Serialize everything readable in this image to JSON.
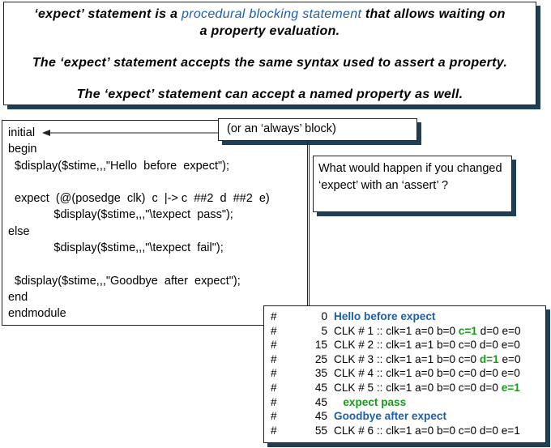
{
  "top": {
    "line1a": "‘expect’ statement is a ",
    "line1b": "procedural blocking statement",
    "line1c": " that allows waiting on",
    "line2": "a property evaluation.",
    "line3": "The ‘expect’ statement accepts the same syntax used to assert a property.",
    "line4": "The ‘expect’ statement can accept a named property as well."
  },
  "code": {
    "lines": [
      "initial",
      "begin",
      "  $display($stime,,,\"Hello  before  expect\");",
      "",
      "  expect  (@(posedge  clk)  c  |-> c  ##2  d  ##2  e)",
      "              $display($stime,,,\"\\texpect  pass\");",
      "else",
      "              $display($stime,,,\"\\texpect  fail\");",
      "",
      "  $display($stime,,,\"Goodbye  after  expect\");",
      "end",
      "endmodule"
    ]
  },
  "callout": {
    "text": "(or an ‘always’ block)"
  },
  "question": {
    "text": "What would happen if you changed ‘expect’ with an ‘assert’ ?"
  },
  "output": {
    "hash": "#",
    "rows": [
      {
        "time": "0",
        "pre": "",
        "hl": "Hello before expect",
        "post": "",
        "hl_color": "blue"
      },
      {
        "time": "5",
        "pre": "CLK # 1 :: clk=1 a=0 b=0 ",
        "hl": "c=1",
        "post": " d=0 e=0",
        "hl_color": "green"
      },
      {
        "time": "15",
        "pre": "CLK # 2 :: clk=1 a=1 b=0 c=0 d=0 e=0",
        "hl": "",
        "post": "",
        "hl_color": "none"
      },
      {
        "time": "25",
        "pre": "CLK # 3 :: clk=1 a=1 b=0 c=0 ",
        "hl": "d=1",
        "post": " e=0",
        "hl_color": "green"
      },
      {
        "time": "35",
        "pre": "CLK # 4 :: clk=1 a=0 b=0 c=0 d=0 e=0",
        "hl": "",
        "post": "",
        "hl_color": "none"
      },
      {
        "time": "45",
        "pre": "CLK # 5 :: clk=1 a=0 b=0 c=0 d=0 ",
        "hl": "e=1",
        "post": "",
        "hl_color": "green"
      },
      {
        "time": "45",
        "pre": "   ",
        "hl": "expect pass",
        "post": "",
        "hl_color": "green"
      },
      {
        "time": "45",
        "pre": "",
        "hl": "Goodbye after expect",
        "post": "",
        "hl_color": "blue"
      },
      {
        "time": "55",
        "pre": "CLK # 6 :: clk=1 a=0 b=0 c=0 d=0 e=1",
        "hl": "",
        "post": "",
        "hl_color": "none"
      }
    ]
  },
  "colors": {
    "accent_blue": "#1f5fa8",
    "accent_green": "#1a9a1a",
    "shadow": "#1f3f59"
  }
}
